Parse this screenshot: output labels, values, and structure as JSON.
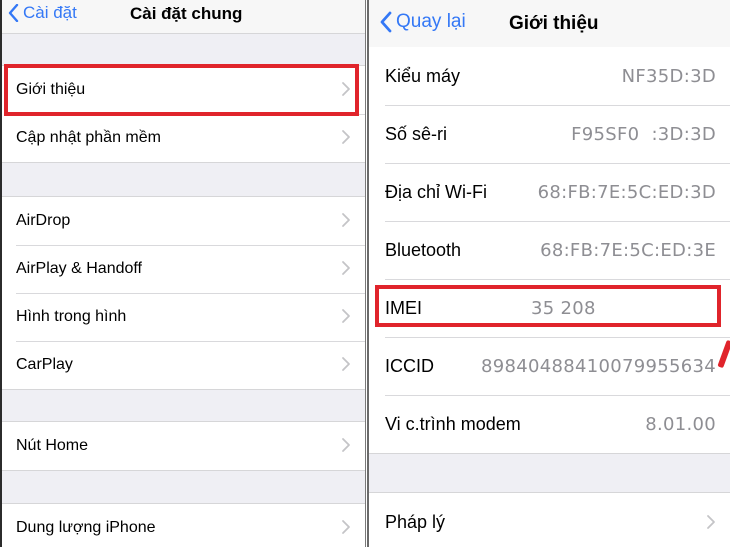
{
  "left_screen": {
    "nav": {
      "back_label": "Cài đặt",
      "title": "Cài đặt chung"
    },
    "groups": [
      {
        "items": [
          {
            "label": "Giới thiệu",
            "highlighted": true
          },
          {
            "label": "Cập nhật phần mềm"
          }
        ]
      },
      {
        "items": [
          {
            "label": "AirDrop"
          },
          {
            "label": "AirPlay & Handoff"
          },
          {
            "label": "Hình trong hình"
          },
          {
            "label": "CarPlay"
          }
        ]
      },
      {
        "items": [
          {
            "label": "Nút Home"
          }
        ]
      },
      {
        "items": [
          {
            "label": "Dung lượng iPhone"
          }
        ]
      }
    ]
  },
  "right_screen": {
    "nav": {
      "back_label": "Quay lại",
      "title": "Giới thiệu"
    },
    "info_rows": [
      {
        "label": "Kiểu máy",
        "value": "NF35D:3D"
      },
      {
        "label": "Số sê-ri",
        "value": "F95SF0  :3D:3D"
      },
      {
        "label": "Địa chỉ Wi-Fi",
        "value": "68:FB:7E:5C:ED:3D"
      },
      {
        "label": "Bluetooth",
        "value": "68:FB:7E:5C:ED:3E"
      },
      {
        "label": "IMEI",
        "value": "35 208",
        "highlighted": true
      },
      {
        "label": "ICCID",
        "value": "89840488410079955634"
      },
      {
        "label": "Vi c.trình modem",
        "value": "8.01.00"
      }
    ],
    "legal_group": {
      "label": "Pháp lý"
    }
  },
  "colors": {
    "accent": "#3478f6",
    "highlight": "#e0242b",
    "secondary_text": "#8e8e93",
    "grouped_background": "#efeff4"
  }
}
